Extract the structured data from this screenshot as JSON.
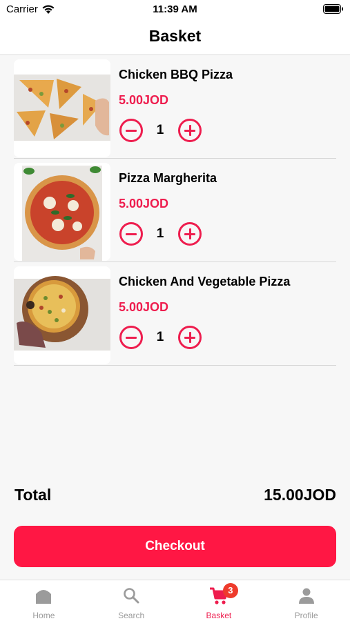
{
  "status_bar": {
    "carrier": "Carrier",
    "time": "11:39 AM"
  },
  "header": {
    "title": "Basket"
  },
  "basket": {
    "items": [
      {
        "name": "Chicken BBQ Pizza",
        "price": "5.00JOD",
        "quantity": "1",
        "image": "chicken-bbq-pizza-photo"
      },
      {
        "name": "Pizza Margherita",
        "price": "5.00JOD",
        "quantity": "1",
        "image": "pizza-margherita-photo"
      },
      {
        "name": "Chicken And Vegetable Pizza",
        "price": "5.00JOD",
        "quantity": "1",
        "image": "chicken-vegetable-pizza-photo"
      }
    ]
  },
  "total": {
    "label": "Total",
    "value": "15.00JOD"
  },
  "checkout": {
    "label": "Checkout"
  },
  "tab_bar": {
    "tabs": [
      {
        "label": "Home",
        "icon": "home-icon"
      },
      {
        "label": "Search",
        "icon": "search-icon"
      },
      {
        "label": "Basket",
        "icon": "cart-icon",
        "badge": "3",
        "active": true
      },
      {
        "label": "Profile",
        "icon": "person-icon"
      }
    ]
  },
  "colors": {
    "accent": "#ee1d4e",
    "checkout": "#ff1744",
    "badge": "#ee3b2c",
    "inactive_tab": "#9b9b9b"
  }
}
